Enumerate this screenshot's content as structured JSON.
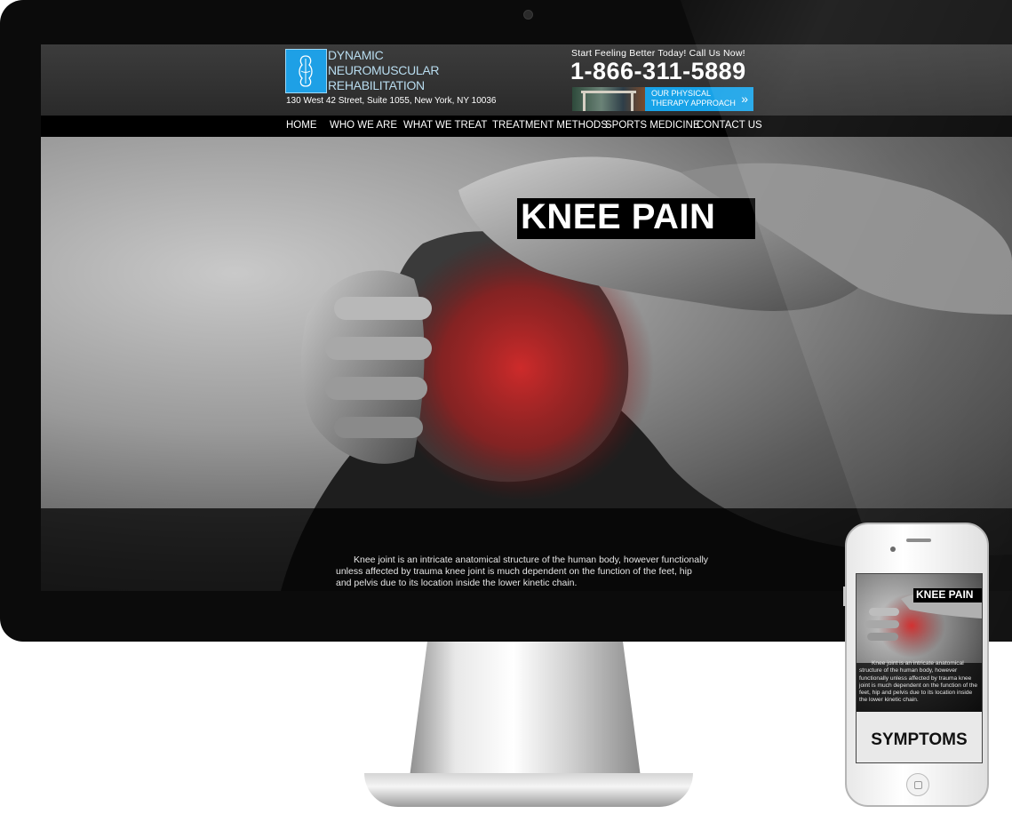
{
  "site": {
    "logo_lines": [
      "DYNAMIC",
      "NEUROMUSCULAR",
      "REHABILITATION"
    ],
    "address": "130 West 42 Street, Suite 1055, New York, NY 10036",
    "tagline": "Start Feeling Better Today! Call Us Now!",
    "phone": "1-866-311-5889",
    "pt_banner": {
      "line1": "OUR PHYSICAL",
      "line2": "THERAPY APPROACH"
    }
  },
  "nav": {
    "items": [
      {
        "label": "HOME"
      },
      {
        "label": "WHO WE ARE"
      },
      {
        "label": "WHAT WE TREAT"
      },
      {
        "label": "TREATMENT METHODS"
      },
      {
        "label": "SPORTS MEDICINE"
      },
      {
        "label": "CONTACT US"
      }
    ]
  },
  "hero": {
    "title": "KNEE PAIN",
    "text": "Knee joint is an intricate anatomical structure of the human body, however functionally unless affected by trauma knee joint is much dependent on the function of the feet, hip and pelvis due to its location inside the lower kinetic chain.",
    "accent_color": "#c81e1e"
  },
  "mobile": {
    "title": "KNEE PAIN",
    "text": "Knee joint is an intricate anatomical structure of the human body, however functionally unless affected by trauma knee joint is much dependent on the function of the feet, hip and pelvis due to its location inside the lower kinetic chain.",
    "section_heading": "SYMPTOMS"
  },
  "colors": {
    "brand_blue": "#1ea0e6",
    "nav_bg": "#000000",
    "header_bg": "#333333"
  }
}
